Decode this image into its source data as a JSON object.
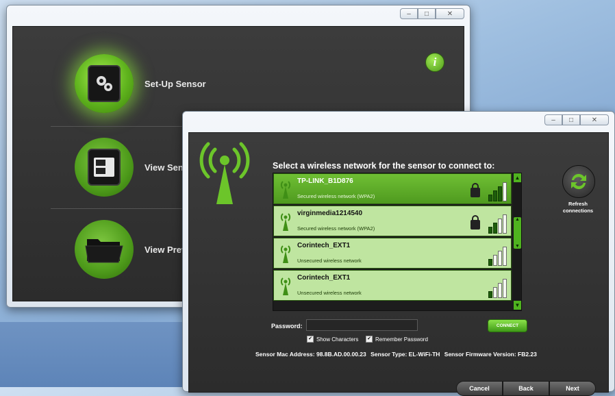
{
  "back_window": {
    "controls": [
      "–",
      "□",
      "✕"
    ],
    "info_label": "i",
    "menu": [
      {
        "label": "Set-Up Sensor",
        "icon": "gears-icon"
      },
      {
        "label": "View Sensor",
        "icon": "sensor-display-icon"
      },
      {
        "label": "View Previo",
        "icon": "folder-icon"
      }
    ]
  },
  "front_window": {
    "controls": [
      "–",
      "□",
      "✕"
    ],
    "heading": "Select a wireless network for the sensor to connect to:",
    "networks": [
      {
        "ssid": "TP-LINK_B1D876",
        "desc": "Secured wireless network (WPA2)",
        "secured": true,
        "signal": 3,
        "selected": true
      },
      {
        "ssid": "virginmedia1214540",
        "desc": "Secured wireless network (WPA2)",
        "secured": true,
        "signal": 2,
        "selected": false
      },
      {
        "ssid": "Corintech_EXT1",
        "desc": "Unsecured wireless network",
        "secured": false,
        "signal": 1,
        "selected": false
      },
      {
        "ssid": "Corintech_EXT1",
        "desc": "Unsecured wireless network",
        "secured": false,
        "signal": 1,
        "selected": false
      }
    ],
    "password": {
      "label": "Password:",
      "value": ""
    },
    "connect_label": "CONNECT",
    "show_characters": {
      "label": "Show Characters",
      "checked": true
    },
    "remember_password": {
      "label": "Remember Password",
      "checked": true
    },
    "sensor_info": {
      "mac": "Sensor Mac Address: 98.8B.AD.00.00.23",
      "type": "Sensor Type: EL-WiFi-TH",
      "firmware": "Sensor Firmware Version: FB2.23"
    },
    "refresh_label": "Refresh connections",
    "buttons": {
      "cancel": "Cancel",
      "back": "Back",
      "next": "Next"
    }
  },
  "colors": {
    "accent": "#5fb31d",
    "selected_row": "#5aa826",
    "row": "#bfe5a0",
    "panel": "#333333"
  }
}
